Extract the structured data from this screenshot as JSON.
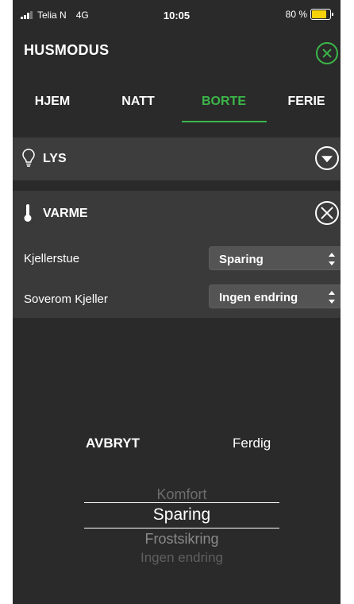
{
  "status_bar": {
    "carrier": "Telia N",
    "network": "4G",
    "time": "10:05",
    "battery_percent": "80 %",
    "battery_level": 0.8
  },
  "header": {
    "title": "HUSMODUS"
  },
  "tabs": [
    {
      "label": "HJEM",
      "active": false
    },
    {
      "label": "NATT",
      "active": false
    },
    {
      "label": "BORTE",
      "active": true
    },
    {
      "label": "FERIE",
      "active": false
    }
  ],
  "sections": {
    "lys": {
      "title": "LYS"
    },
    "varme": {
      "title": "VARME",
      "rows": [
        {
          "label": "Kjellerstue",
          "value": "Sparing"
        },
        {
          "label": "Soverom Kjeller",
          "value": "Ingen endring"
        }
      ]
    }
  },
  "picker": {
    "cancel_label": "AVBRYT",
    "done_label": "Ferdig",
    "options": [
      "Komfort",
      "Sparing",
      "Frostsikring",
      "Ingen endring"
    ],
    "selected": "Sparing"
  },
  "colors": {
    "accent": "#3cb649",
    "background": "#2a2a2a",
    "section_bar": "#3d3d3d",
    "battery": "#f5d20a"
  }
}
